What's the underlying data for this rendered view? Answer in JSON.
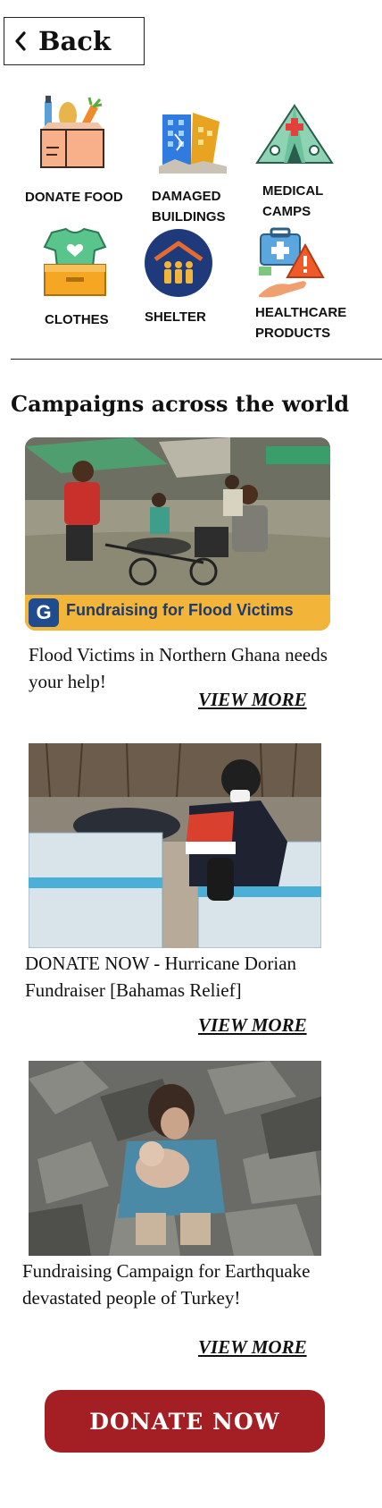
{
  "header": {
    "back_label": "Back"
  },
  "categories": [
    {
      "label_line1": "DONATE FOOD",
      "label_line2": "",
      "icon": "food-basket-icon"
    },
    {
      "label_line1": "DAMAGED",
      "label_line2": "BUILDINGS",
      "icon": "damaged-buildings-icon"
    },
    {
      "label_line1": "MEDICAL",
      "label_line2": "CAMPS",
      "icon": "medical-tent-icon"
    },
    {
      "label_line1": "CLOTHES",
      "label_line2": "",
      "icon": "clothes-box-icon"
    },
    {
      "label_line1": "SHELTER",
      "label_line2": "",
      "icon": "shelter-house-icon"
    },
    {
      "label_line1": "HEALTHCARE",
      "label_line2": "PRODUCTS",
      "icon": "first-aid-kit-icon"
    }
  ],
  "section": {
    "title": "Campaigns across the world"
  },
  "campaigns": [
    {
      "title": "Flood Victims in Northern Ghana needs your help!",
      "banner_text": "Fundraising for Flood Victims",
      "banner_logo": "G",
      "view_more": "VIEW MORE"
    },
    {
      "title": "DONATE NOW - Hurricane Dorian Fundraiser [Bahamas Relief]",
      "view_more": "VIEW MORE"
    },
    {
      "title": "Fundraising Campaign for Earthquake devastated people of Turkey!",
      "view_more": "VIEW MORE"
    }
  ],
  "cta": {
    "donate_label": "DONATE  NOW"
  },
  "colors": {
    "accent": "#a31f23",
    "banner": "#f2b53a",
    "shelter_bg": "#1f3a7a"
  }
}
